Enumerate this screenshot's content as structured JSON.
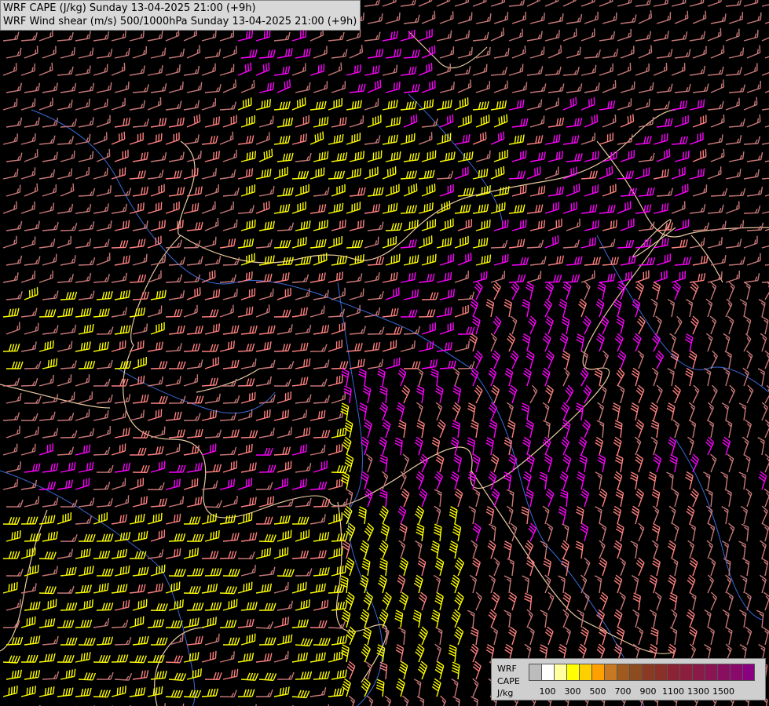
{
  "title": {
    "line1": "WRF CAPE (J/kg) Sunday 13-04-2025 21:00 (+9h)",
    "line2": "WRF Wind shear (m/s) 500/1000hPa Sunday 13-04-2025 21:00 (+9h)"
  },
  "legend": {
    "model": "WRF",
    "field": "CAPE",
    "unit": "J/kg",
    "colors": [
      "#bcbcbc",
      "#ffffff",
      "#ffffa0",
      "#ffff00",
      "#ffd000",
      "#ffa000",
      "#c87820",
      "#a05a1e",
      "#8c4c20",
      "#8a3a24",
      "#8a3028",
      "#8a2434",
      "#8a1e3c",
      "#8a1a48",
      "#8a1454",
      "#8a0e60",
      "#8a0a6c",
      "#8a0080"
    ],
    "tick_labels": [
      {
        "label": "100",
        "index": 1
      },
      {
        "label": "300",
        "index": 3
      },
      {
        "label": "500",
        "index": 5
      },
      {
        "label": "700",
        "index": 7
      },
      {
        "label": "900",
        "index": 9
      },
      {
        "label": "1100",
        "index": 11
      },
      {
        "label": "1300",
        "index": 13
      },
      {
        "label": "1500",
        "index": 15
      }
    ]
  },
  "map": {
    "barb_colors": {
      "yellow": "#ffff00",
      "magenta": "#ff00ff",
      "salmon": "#ff8080",
      "rose": "#c87878"
    },
    "border_color": "#e8c8a0",
    "river_color": "#3a6ad8"
  }
}
